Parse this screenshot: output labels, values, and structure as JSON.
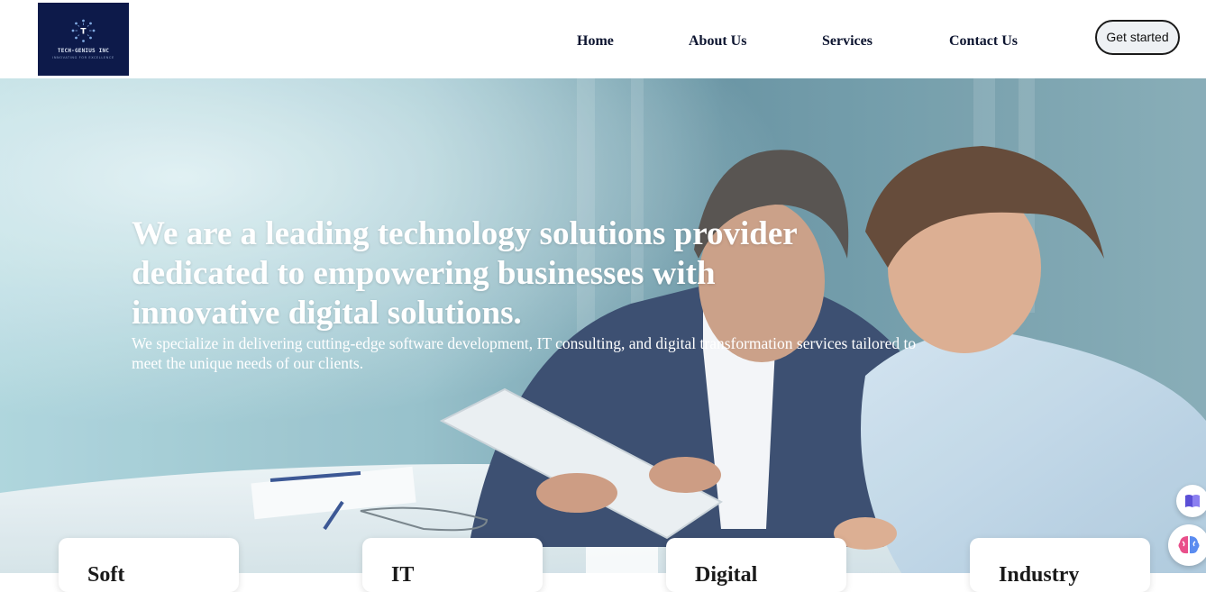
{
  "header": {
    "logo": {
      "letter": "T",
      "name": "TECH-GENIUS INC",
      "tagline": "INNOVATING FOR EXCELLENCE"
    },
    "nav": [
      {
        "label": "Home"
      },
      {
        "label": "About Us"
      },
      {
        "label": "Services"
      },
      {
        "label": "Contact Us"
      }
    ],
    "cta_label": "Get started"
  },
  "hero": {
    "title": "We are a leading technology solutions provider dedicated to empowering businesses with innovative digital solutions.",
    "subtitle": "We specialize in delivering cutting-edge software development, IT consulting, and digital transformation services tailored to meet the unique needs of our clients."
  },
  "cards": [
    {
      "title": "Soft"
    },
    {
      "title": "IT"
    },
    {
      "title": "Digital"
    },
    {
      "title": "Industry"
    }
  ],
  "floating": [
    {
      "icon": "book-icon"
    },
    {
      "icon": "brain-icon"
    }
  ],
  "colors": {
    "brand_navy": "#0d1a4a",
    "nav_text": "#0d1530",
    "hero_overlay": "#9cc7d1"
  }
}
